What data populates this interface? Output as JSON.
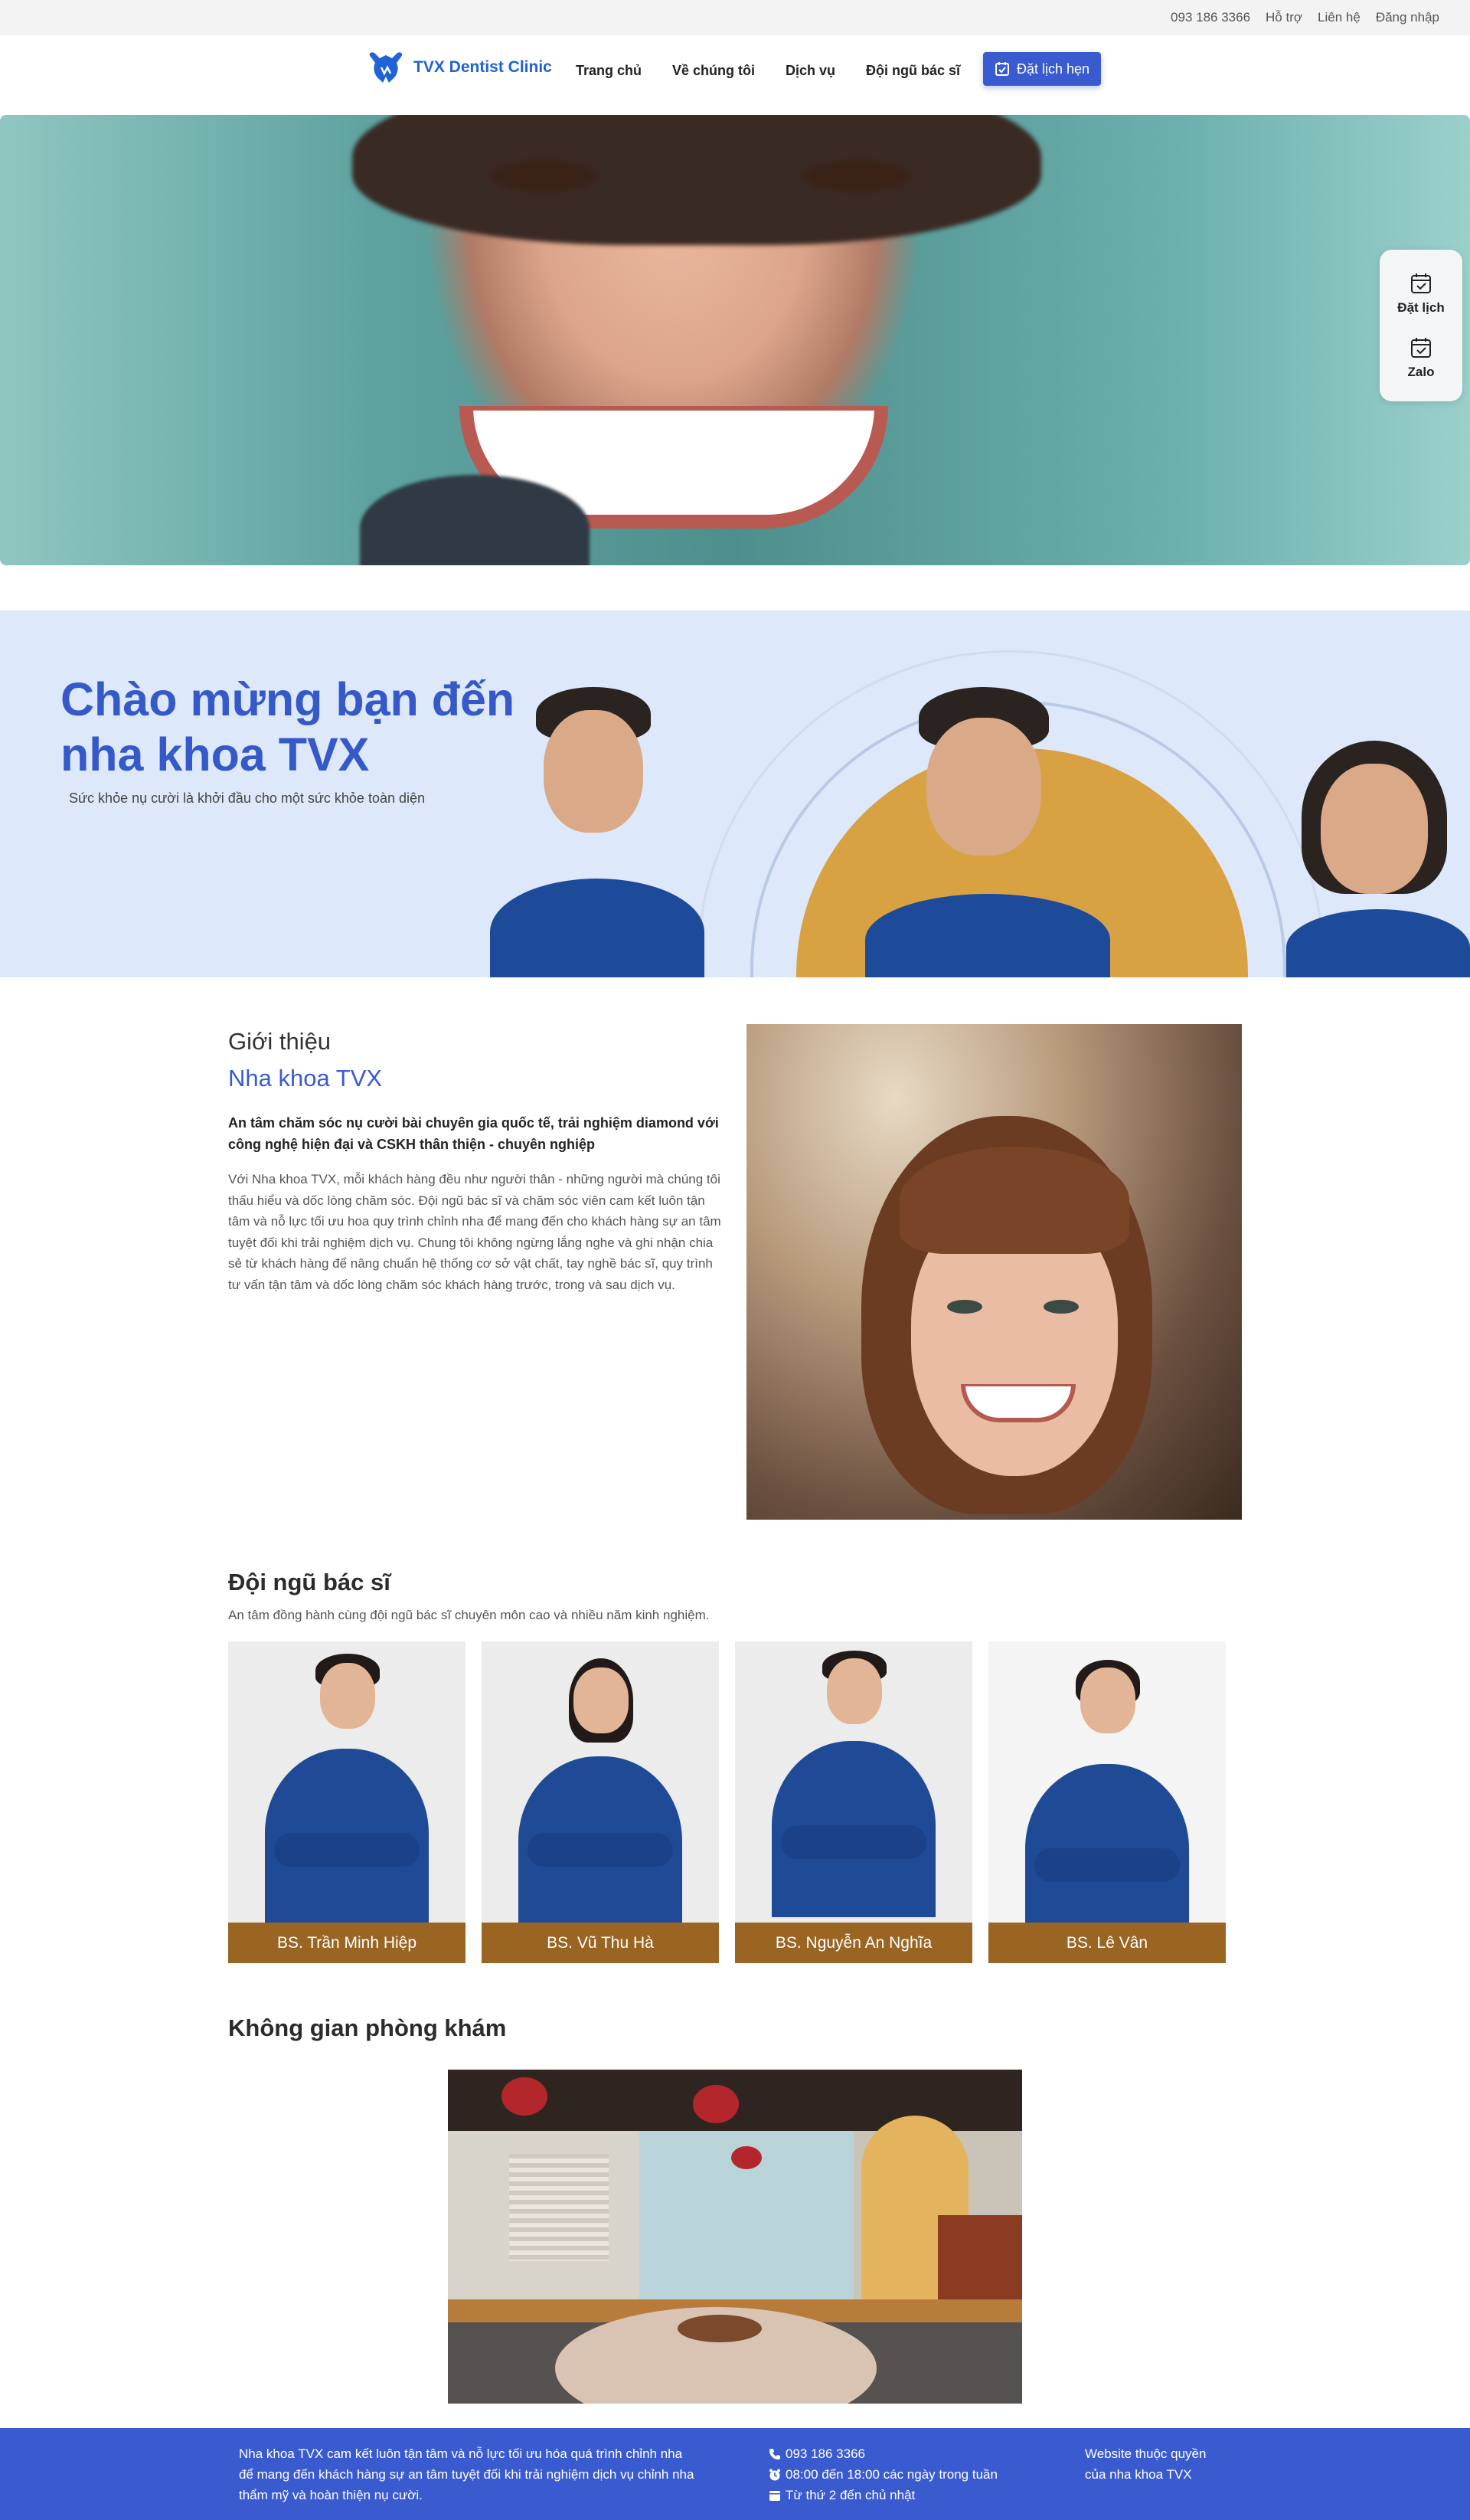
{
  "topbar": {
    "phone": "093 186 3366",
    "support": "Hỗ trợ",
    "contact": "Liên hệ",
    "login": "Đăng nhập"
  },
  "nav": {
    "brand": "TVX Dentist Clinic",
    "items": [
      "Trang chủ",
      "Về chúng tôi",
      "Dịch vụ",
      "Đội ngũ bác sĩ"
    ],
    "book_button": "Đặt lịch hẹn"
  },
  "side_widget": {
    "book": "Đặt lịch",
    "zalo": "Zalo"
  },
  "welcome": {
    "title_line1": "Chào mừng bạn đến",
    "title_line2": "nha khoa TVX",
    "subtitle": "Sức khỏe nụ cười là khởi đầu cho một sức khỏe toàn diện"
  },
  "intro": {
    "label": "Giới thiệu",
    "name": "Nha khoa TVX",
    "lead": "An tâm chăm sóc nụ cười bài chuyên gia quốc tế, trải nghiệm diamond với công nghệ hiện đại và CSKH thân thiện - chuyên nghiệp",
    "body": "Với Nha khoa TVX, mỗi khách hàng đều như người thân - những người mà chúng tôi thấu hiểu và dốc lòng chăm sóc. Đội ngũ bác sĩ và chăm sóc viên cam kết luôn tận tâm và nỗ lực tối ưu hoa quy trình chỉnh nha để mang đến cho khách hàng sự an tâm tuyệt đối khi trải nghiệm dịch vụ. Chung tôi không ngừng lắng nghe và ghi nhận chia sẻ từ khách hàng để nâng chuẩn hệ thống cơ sở vật chất, tay nghề bác sĩ, quy trình tư vấn tận tâm và dốc lòng chăm sóc khách hàng trước, trong và sau dịch vụ."
  },
  "doctors": {
    "title": "Đội ngũ bác sĩ",
    "subtitle": "An tâm đồng hành cùng đội ngũ bác sĩ chuyên môn cao và nhiều năm kinh nghiệm.",
    "list": [
      {
        "name": "BS. Trần Minh Hiệp"
      },
      {
        "name": "BS. Vũ Thu Hà"
      },
      {
        "name": "BS. Nguyễn An Nghĩa"
      },
      {
        "name": "BS. Lê Vân"
      }
    ]
  },
  "clinic": {
    "title": "Không gian phòng khám"
  },
  "footer": {
    "about_line1": "Nha khoa TVX cam kết luôn tận tâm và nỗ lực tối ưu hóa quá trình chỉnh nha",
    "about_line2": "để mang đến khách hàng sự an tâm tuyệt đối khi trải nghiệm dịch vụ chỉnh nha",
    "about_line3": "thẩm mỹ và hoàn thiện nụ cười.",
    "phone": "093 186 3366",
    "hours": "08:00 đến 18:00 các ngày trong tuần",
    "days": "Từ thứ 2 đến chủ nhật",
    "owner_line1": "Website thuộc quyền",
    "owner_line2": "của nha khoa TVX"
  },
  "colors": {
    "brand_blue": "#3a5bd0",
    "link_blue": "#1f63d6",
    "banner_bg": "#dde9fb",
    "name_bar": "#9a6522"
  },
  "icons": [
    "tooth-logo-icon",
    "calendar-check-icon",
    "phone-icon",
    "clock-icon",
    "calendar-icon"
  ]
}
